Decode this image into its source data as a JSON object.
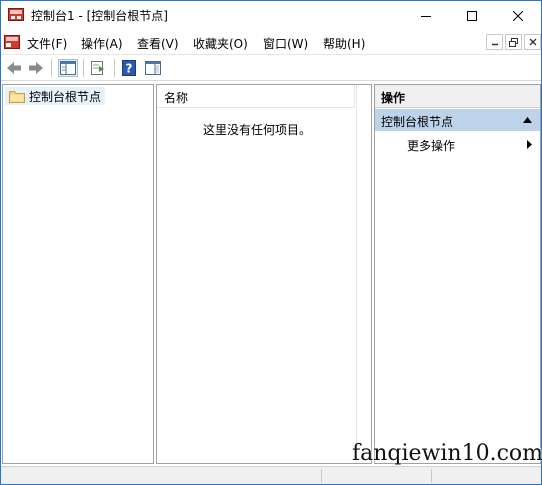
{
  "window": {
    "title": "控制台1 - [控制台根节点]"
  },
  "menu": {
    "items": [
      {
        "label": "文件(F)"
      },
      {
        "label": "操作(A)"
      },
      {
        "label": "查看(V)"
      },
      {
        "label": "收藏夹(O)"
      },
      {
        "label": "窗口(W)"
      },
      {
        "label": "帮助(H)"
      }
    ]
  },
  "tree": {
    "root_label": "控制台根节点"
  },
  "list": {
    "column_name": "名称",
    "empty_message": "这里没有任何项目。"
  },
  "actions": {
    "header": "操作",
    "group_label": "控制台根节点",
    "items": [
      {
        "label": "更多操作"
      }
    ]
  },
  "watermark": {
    "text": "fanqiewin10.com"
  },
  "colors": {
    "accent_border": "#2b74c7",
    "selection_bg": "#e5f1fb",
    "action_group_bg": "#bcd3ea"
  }
}
